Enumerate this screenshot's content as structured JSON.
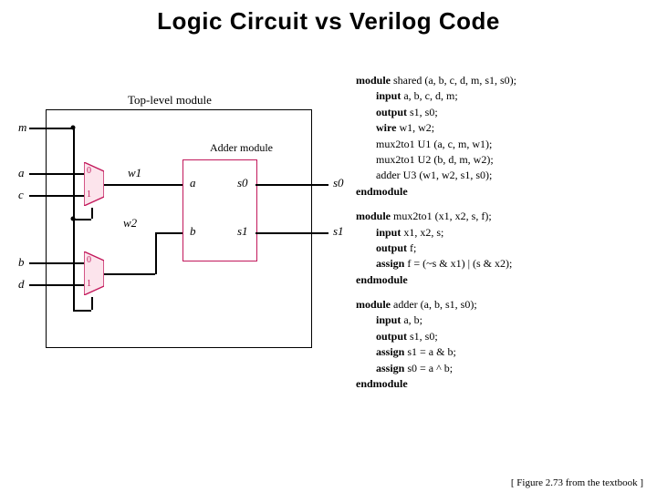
{
  "title": "Logic Circuit vs Verilog Code",
  "footer": "[ Figure 2.73 from the textbook ]",
  "diagram": {
    "top_label": "Top-level module",
    "adder_label": "Adder module",
    "ports": {
      "m": "m",
      "a": "a",
      "c": "c",
      "b": "b",
      "d": "d"
    },
    "internal": {
      "w1": "w1",
      "w2": "w2"
    },
    "adder_ports": {
      "a": "a",
      "b": "b",
      "s0": "s0",
      "s1": "s1"
    },
    "outputs": {
      "s0": "s0",
      "s1": "s1"
    },
    "mux_labels": {
      "zero": "0",
      "one": "1"
    }
  },
  "code": {
    "mod1": {
      "decl": "module",
      "name": " shared (a, b, c, d, m, s1, s0);",
      "l1k": "input",
      "l1": " a, b, c, d, m;",
      "l2k": "output",
      "l2": " s1, s0;",
      "l3k": "wire",
      "l3": " w1, w2;",
      "l4": "mux2to1 U1 (a, c, m, w1);",
      "l5": "mux2to1 U2 (b, d, m, w2);",
      "l6": "adder U3 (w1, w2, s1, s0);",
      "end": "endmodule"
    },
    "mod2": {
      "decl": "module",
      "name": " mux2to1 (x1, x2, s, f);",
      "l1k": "input",
      "l1": " x1, x2, s;",
      "l2k": "output",
      "l2": " f;",
      "l3k": "assign",
      "l3": " f = (~s & x1) | (s & x2);",
      "end": "endmodule"
    },
    "mod3": {
      "decl": "module",
      "name": " adder (a, b, s1, s0);",
      "l1k": "input",
      "l1": " a, b;",
      "l2k": "output",
      "l2": " s1, s0;",
      "l3k": "assign",
      "l3": " s1 = a & b;",
      "l4k": "assign",
      "l4": " s0 = a ^ b;",
      "end": "endmodule"
    }
  }
}
